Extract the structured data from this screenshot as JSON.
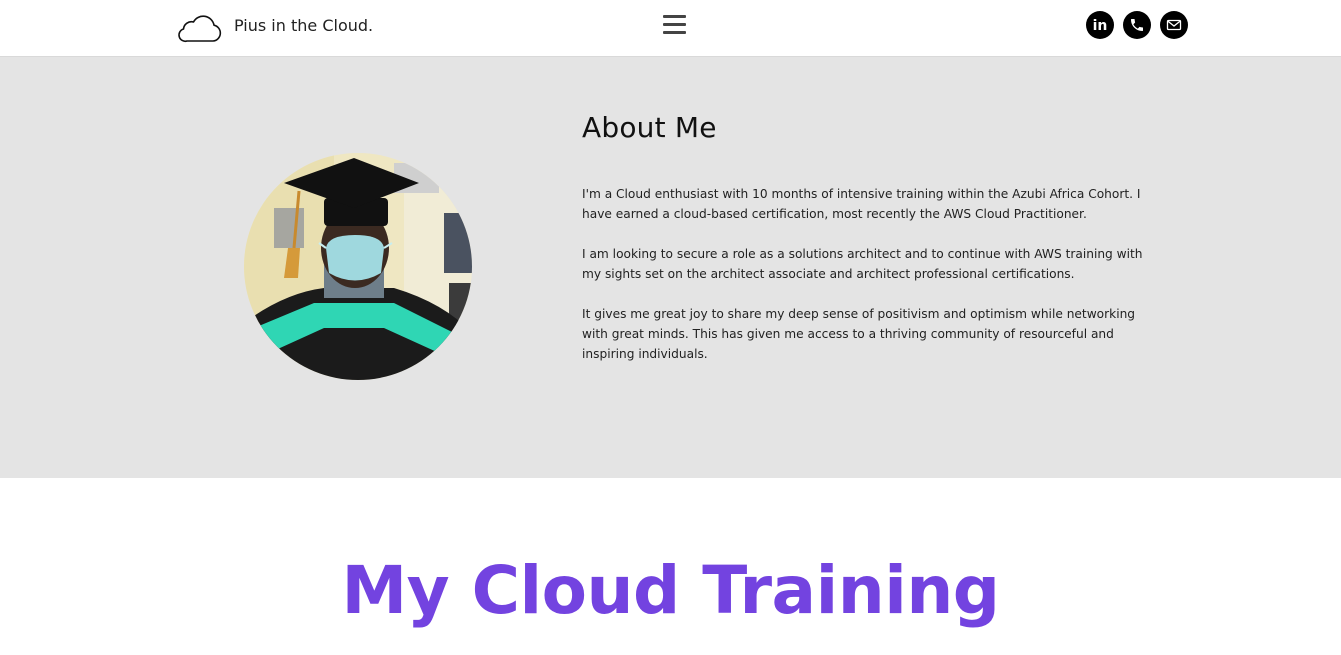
{
  "header": {
    "brand_name": "Pius in the Cloud.",
    "logo_icon": "cloud-outline-icon",
    "menu_icon": "hamburger-menu-icon",
    "social_links": [
      {
        "name": "linkedin",
        "icon": "linkedin-icon",
        "label": "in"
      },
      {
        "name": "phone",
        "icon": "phone-icon"
      },
      {
        "name": "email",
        "icon": "mail-icon"
      }
    ]
  },
  "about": {
    "title": "About Me",
    "photo": "profile-photo-graduation",
    "paragraphs": [
      "I'm a Cloud enthusiast with 10 months of intensive training within the Azubi Africa Cohort. I have earned a cloud-based certification, most recently the AWS Cloud Practitioner.",
      "I am looking to secure a role as a solutions architect and to continue with AWS training with my sights set on the architect associate and architect professional certifications.",
      "It gives me great joy to share my deep sense of positivism and optimism while networking with great minds. This has given me access to a thriving community of resourceful and inspiring individuals."
    ]
  },
  "training": {
    "title": "My Cloud Training"
  },
  "colors": {
    "accent": "#7343e0",
    "about_bg": "#e4e4e4",
    "header_bg": "#ffffff",
    "social_bg": "#000000"
  }
}
